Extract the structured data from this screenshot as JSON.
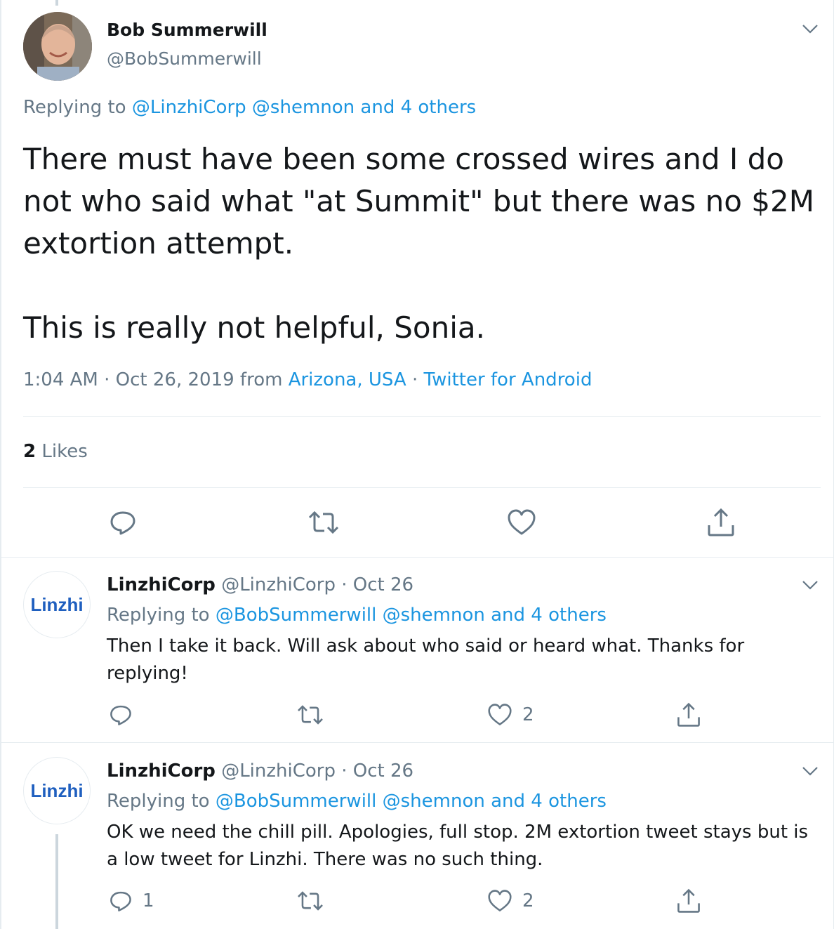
{
  "main_tweet": {
    "author_name": "Bob Summerwill",
    "author_handle": "@BobSummerwill",
    "replying_prefix": "Replying to",
    "replying_to": [
      "@LinzhiCorp",
      "@shemnon",
      "and 4 others"
    ],
    "text": "There must have been some crossed wires and I do not who said what \"at Summit\" but there was no $2M extortion attempt.\n\nThis is really not helpful, Sonia.",
    "time": "1:04 AM · Oct 26, 2019 from",
    "location": "Arizona, USA",
    "dot": "·",
    "source": "Twitter for Android",
    "likes_count": "2",
    "likes_label": "Likes",
    "actions": [
      "reply-icon",
      "retweet-icon",
      "like-icon",
      "share-icon"
    ]
  },
  "replies": [
    {
      "avatar_text": "Linzhi",
      "author_name": "LinzhiCorp",
      "author_handle": "@LinzhiCorp",
      "date": "· Oct 26",
      "replying_prefix": "Replying to",
      "replying_to": [
        "@BobSummerwill",
        "@shemnon",
        "and 4 others"
      ],
      "text": "Then I take it back. Will ask about who said or heard what. Thanks for replying!",
      "reply_count": "",
      "like_count": "2"
    },
    {
      "avatar_text": "Linzhi",
      "author_name": "LinzhiCorp",
      "author_handle": "@LinzhiCorp",
      "date": "· Oct 26",
      "replying_prefix": "Replying to",
      "replying_to": [
        "@BobSummerwill",
        "@shemnon",
        "and 4 others"
      ],
      "text": "OK we need the chill pill. Apologies, full stop. 2M extortion tweet stays but is a low tweet for Linzhi. There was no such thing.",
      "reply_count": "1",
      "like_count": "2"
    }
  ],
  "colors": {
    "link": "#1b95e0",
    "muted": "#657786",
    "text": "#14171a",
    "border": "#e6ecf0",
    "linzhi_logo": "#1f5fbf"
  }
}
